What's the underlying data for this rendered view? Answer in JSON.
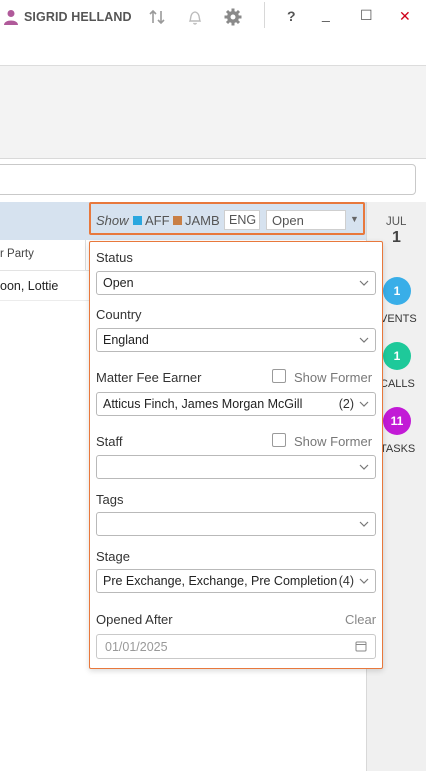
{
  "app": {
    "user_name": "SIGRID HELLAND",
    "window_controls": {
      "help": "?",
      "minimize": "_",
      "maximize": "☐",
      "close": "✕"
    }
  },
  "grid": {
    "column_partial": "r Party",
    "row_partial": "oon, Lottie"
  },
  "show_bar": {
    "show_label": "Show",
    "aff_label": "AFF",
    "aff_color": "#2aa7df",
    "jamb_label": "JAMB",
    "jamb_color": "#c97f45",
    "country_code": "ENG",
    "status_value": "Open"
  },
  "side_panel": {
    "month": "JUL",
    "day": "1",
    "events_count": "1",
    "events_label": "VENTS",
    "calls_count": "1",
    "calls_label": "CALLS",
    "tasks_count": "11",
    "tasks_label": "TASKS"
  },
  "filters": {
    "status_label": "Status",
    "status_value": "Open",
    "country_label": "Country",
    "country_value": "England",
    "fee_earner_label": "Matter Fee Earner",
    "fee_earner_show_former": "Show Former",
    "fee_earner_value": "Atticus Finch, James Morgan McGill",
    "fee_earner_count": "(2)",
    "staff_label": "Staff",
    "staff_show_former": "Show Former",
    "staff_value": "",
    "tags_label": "Tags",
    "tags_value": "",
    "stage_label": "Stage",
    "stage_value": "Pre Exchange, Exchange, Pre Completion",
    "stage_count": "(4)",
    "opened_after_label": "Opened After",
    "clear_label": "Clear",
    "opened_after_value": "01/01/2025"
  },
  "icons": [
    "user-icon",
    "sync-icon",
    "bell-icon",
    "gear-icon",
    "help-icon",
    "minimize-icon",
    "maximize-icon",
    "close-icon",
    "chevron-down-icon",
    "calendar-icon"
  ]
}
